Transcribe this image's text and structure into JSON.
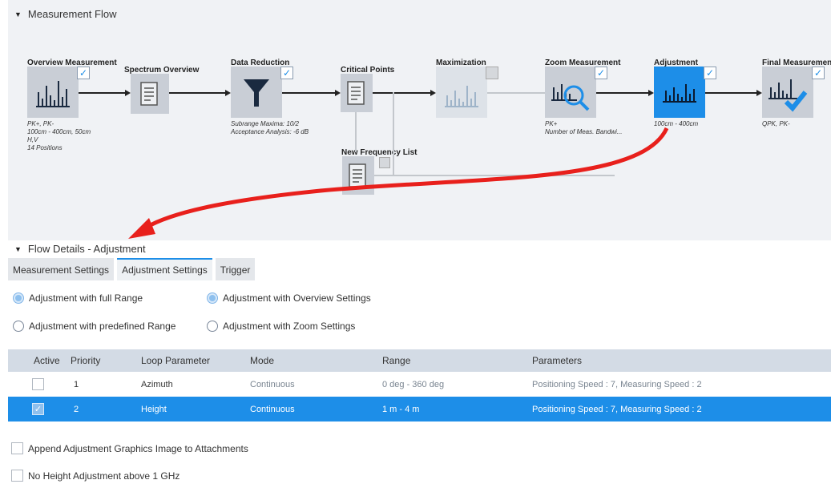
{
  "measurement_flow": {
    "title": "Measurement Flow"
  },
  "nodes": {
    "overview": {
      "title": "Overview Measurement",
      "desc": [
        "PK+, PK-",
        "100cm - 400cm, 50cm",
        "H,V",
        "14 Positions"
      ]
    },
    "spectrum": {
      "title": "Spectrum Overview"
    },
    "reduction": {
      "title": "Data Reduction",
      "desc": [
        "Subrange Maxima: 10/2",
        "Acceptance Analysis: -6 dB"
      ]
    },
    "critical": {
      "title": "Critical Points"
    },
    "maximization": {
      "title": "Maximization"
    },
    "zoom": {
      "title": "Zoom Measurement",
      "desc": [
        "PK+",
        "Number of Meas. Bandwi..."
      ]
    },
    "adjustment": {
      "title": "Adjustment",
      "desc": [
        "100cm - 400cm"
      ]
    },
    "final": {
      "title": "Final Measurement",
      "desc": [
        "QPK, PK-"
      ]
    },
    "newfreq": {
      "title": "New Frequency List"
    }
  },
  "flow_details": {
    "title": "Flow Details  -  Adjustment"
  },
  "tabs": [
    "Measurement Settings",
    "Adjustment Settings",
    "Trigger"
  ],
  "radios": {
    "full_range": "Adjustment with full Range",
    "overview_settings": "Adjustment with Overview Settings",
    "predefined_range": "Adjustment with predefined Range",
    "zoom_settings": "Adjustment with Zoom Settings"
  },
  "table": {
    "headers": {
      "active": "Active",
      "priority": "Priority",
      "loop": "Loop Parameter",
      "mode": "Mode",
      "range": "Range",
      "params": "Parameters"
    },
    "rows": [
      {
        "priority": "1",
        "loop": "Azimuth",
        "mode": "Continuous",
        "range": "0 deg  -  360 deg",
        "params": "Positioning Speed : 7, Measuring Speed : 2",
        "active": false
      },
      {
        "priority": "2",
        "loop": "Height",
        "mode": "Continuous",
        "range": "1 m  -  4 m",
        "params": "Positioning Speed : 7, Measuring Speed : 2",
        "active": true
      }
    ]
  },
  "options": {
    "append_graphics": "Append Adjustment Graphics Image to Attachments",
    "no_height": "No Height Adjustment above 1 GHz"
  },
  "colors": {
    "accent": "#1d8ee8",
    "annotation_arrow": "#e8201c"
  },
  "icons": {
    "chart": "bar-chart-icon",
    "doc": "document-icon",
    "filter": "filter-icon",
    "zoom": "magnifier-icon",
    "check": "check-icon"
  }
}
